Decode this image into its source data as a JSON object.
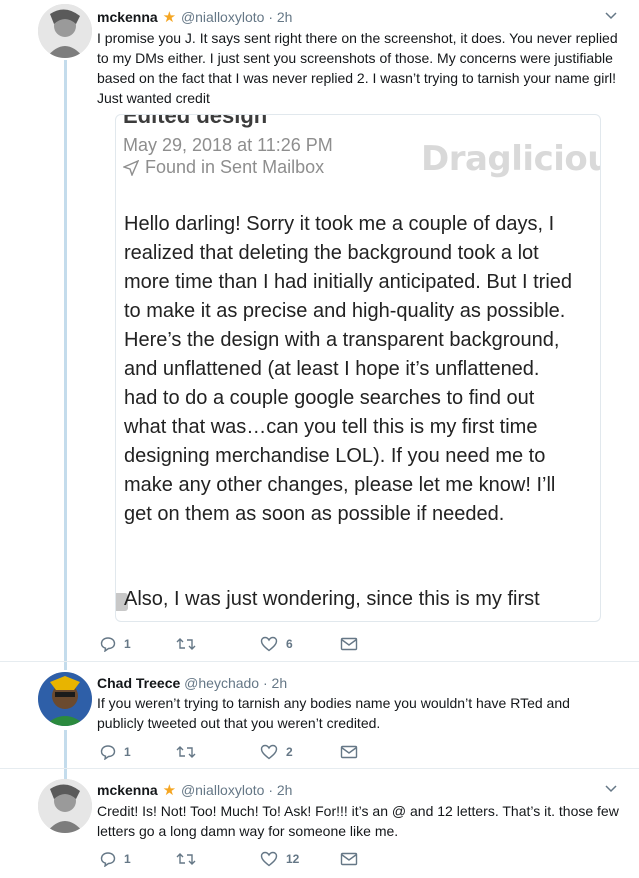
{
  "tweets": [
    {
      "name": "mckenna",
      "star": "★",
      "handle": "@nialloxyloto",
      "dot": "·",
      "time": "2h",
      "text": "I promise you J. It says sent right there on the screenshot, it does. You never replied to my DMs either. I just sent you screenshots of those. My concerns were justifiable based on the fact that I was never replied 2. I wasn’t trying to tarnish your name girl! Just wanted credit",
      "replies": "1",
      "retweets": "",
      "likes": "6"
    },
    {
      "name": "Chad Treece",
      "handle": "@heychado",
      "dot": "·",
      "time": "2h",
      "text": "If you weren’t trying to tarnish any bodies name you wouldn’t have RTed and publicly tweeted out that you weren’t credited.",
      "replies": "1",
      "retweets": "",
      "likes": "2"
    },
    {
      "name": "mckenna",
      "star": "★",
      "handle": "@nialloxyloto",
      "dot": "·",
      "time": "2h",
      "text": "Credit! Is! Not! Too! Much! To! Ask! For!!! it’s an @ and 12 letters. That’s it. those few letters go a long damn way for someone like me.",
      "replies": "1",
      "retweets": "",
      "likes": "12"
    }
  ],
  "email": {
    "title": "Edited design",
    "date": "May 29, 2018 at 11:26 PM",
    "found": "Found in Sent Mailbox",
    "watermark": "Draglicious",
    "body": "Hello darling! Sorry it took me a couple of days, I realized that deleting the background took a lot more time than I had initially anticipated.  But I tried to make it as precise and high-quality as possible.  Here’s the design with a transparent background, and unflattened (at least I hope it’s unflattened. had to do a couple google searches to find out what that was…can you tell this is my first time designing merchandise LOL). If you need me to make any other changes, please let me know! I’ll get on them as soon as possible if needed.",
    "tail": "Also, I was just wondering, since this is my first"
  },
  "colors": {
    "thread_line": "#c4dcec",
    "star": "#f5a623",
    "meta": "#657786"
  }
}
